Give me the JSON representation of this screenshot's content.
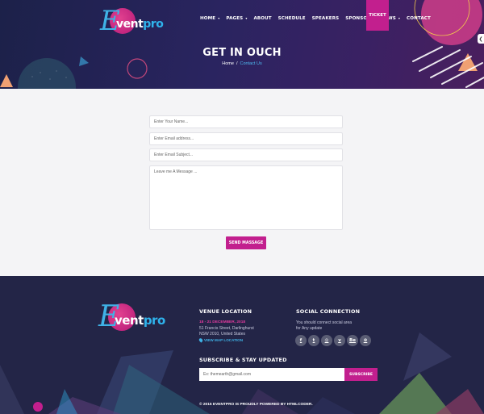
{
  "header": {
    "logo": {
      "letter": "E",
      "word_main": "vent",
      "word_accent": "pro"
    },
    "nav": [
      {
        "label": "Home",
        "has_caret": true
      },
      {
        "label": "Pages",
        "has_caret": true
      },
      {
        "label": "About",
        "has_caret": false
      },
      {
        "label": "Schedule",
        "has_caret": false
      },
      {
        "label": "Speakers",
        "has_caret": false
      },
      {
        "label": "Sponsors",
        "has_caret": false
      },
      {
        "label": "News",
        "has_caret": true
      },
      {
        "label": "Contact",
        "has_caret": false
      }
    ],
    "caret_glyph": "▾",
    "ticket_label": "Ticket",
    "side_tab_glyph": "❮"
  },
  "hero": {
    "title": "GET IN OUCH",
    "breadcrumb": {
      "home": "Home",
      "separator": "/",
      "current": "Contact Us"
    }
  },
  "contact_form": {
    "name_placeholder": "Enter Your Name...",
    "email_placeholder": "Enter Email address...",
    "subject_placeholder": "Enter Email Subject...",
    "message_placeholder": "Leave me A Message ...",
    "send_label": "Send Massage"
  },
  "footer": {
    "venue": {
      "heading": "Venue Location",
      "date": "18 - 21 December, 2018",
      "address_line1": "51 Francis Street, Darlinghurst",
      "address_line2": "NSW 2010, United States",
      "map_link": "View Map Location",
      "map_icon": "pin-icon"
    },
    "social": {
      "heading": "Social Connection",
      "text_line1": "You should connect social area",
      "text_line2": "for Any update",
      "icons": [
        {
          "name": "facebook-icon",
          "glyph": "f"
        },
        {
          "name": "twitter-icon",
          "glyph": "t"
        },
        {
          "name": "instagram-icon",
          "glyph": "◎"
        },
        {
          "name": "vimeo-icon",
          "glyph": "v"
        },
        {
          "name": "behance-icon",
          "glyph": "Be"
        },
        {
          "name": "dribbble-icon",
          "glyph": "⊛"
        }
      ]
    },
    "subscribe": {
      "heading": "Subscribe & Stay Updated",
      "placeholder": "Ex: themearth@gmail.com",
      "button_label": "Subscribe"
    },
    "copyright": "© 2015 EventPro is Proudly Powered by HtmlCoder."
  },
  "colors": {
    "accent": "#c21f8e",
    "link_blue": "#3fb2e6",
    "footer_bg": "#232547",
    "hero_bg": "#2a2460"
  }
}
